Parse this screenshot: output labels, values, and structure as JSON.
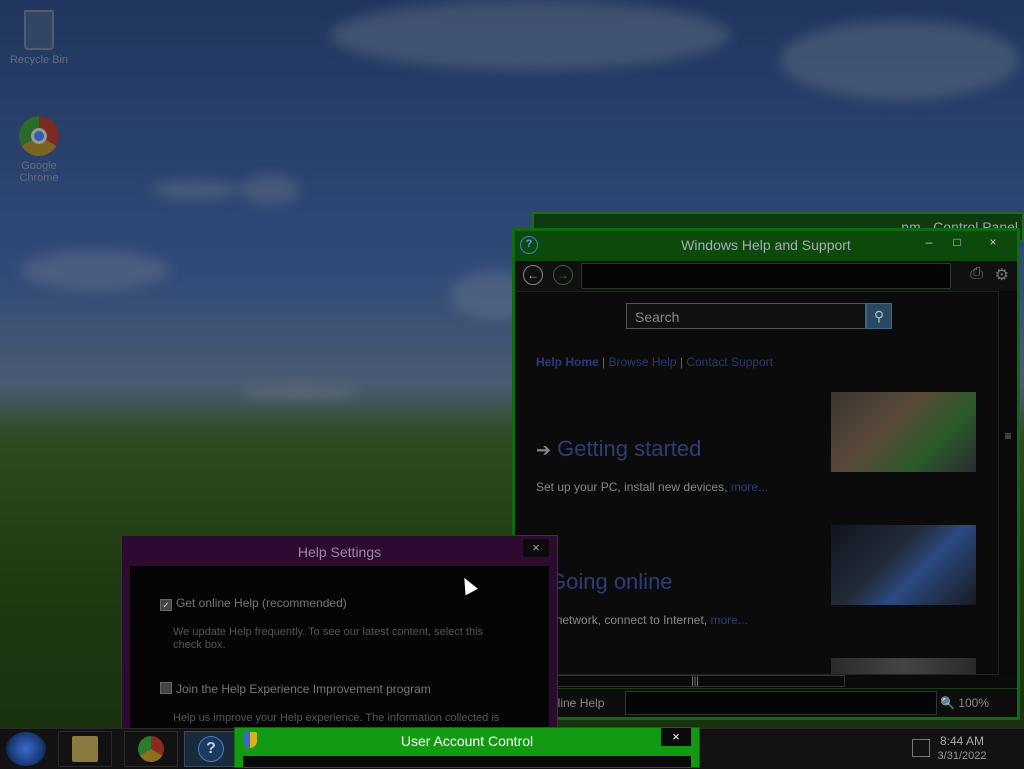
{
  "desktop": {
    "icons": [
      {
        "label": "Recycle Bin"
      },
      {
        "label": "Google\nChrome"
      }
    ]
  },
  "control_panel": {
    "title": "nm - Control Panel"
  },
  "help_window": {
    "title": "Windows Help and Support",
    "search_placeholder": "Search",
    "links": {
      "home": "Help Home",
      "browse": "Browse Help",
      "contact": "Contact Support",
      "sep": "|"
    },
    "topics": [
      {
        "heading": "Getting started",
        "desc": "Set up your PC, install new devices, ",
        "more": "more..."
      },
      {
        "heading": "Going online",
        "desc": "up a network, connect to Internet, ",
        "more": "more..."
      }
    ],
    "status": {
      "online_help": "nline Help",
      "zoom": "100%"
    }
  },
  "help_settings": {
    "title": "Help Settings",
    "option1": {
      "label": "Get online Help (recommended)",
      "checked": true,
      "note": "We update Help frequently. To see our latest content, select this check box."
    },
    "option2": {
      "label": "Join the Help Experience Improvement program",
      "checked": false,
      "note": "Help us improve your Help experience. The information collected is"
    }
  },
  "uac": {
    "title": "User Account Control"
  },
  "taskbar": {
    "time": "8:44 AM",
    "date": "3/31/2022"
  },
  "icons": {
    "close": "×",
    "minimize": "–",
    "maximize": "□",
    "back": "←",
    "forward": "→",
    "print": "⎙",
    "gear": "⚙",
    "search": "⚲",
    "arrow": "➔",
    "help_q": "?",
    "zoom": "🔍"
  }
}
